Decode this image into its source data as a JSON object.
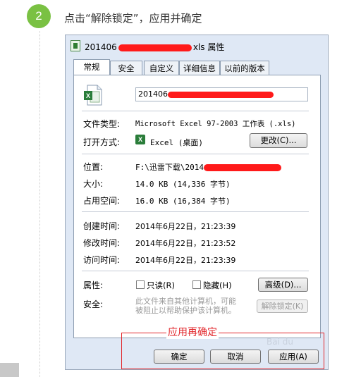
{
  "step": {
    "number": "2",
    "instruction": "点击“解除锁定”，应用并确定"
  },
  "dialog": {
    "title_prefix": "201406",
    "title_suffix": "xls 属性",
    "tabs": [
      {
        "label": "常规",
        "active": true
      },
      {
        "label": "安全",
        "active": false
      },
      {
        "label": "自定义",
        "active": false
      },
      {
        "label": "详细信息",
        "active": false
      },
      {
        "label": "以前的版本",
        "active": false
      }
    ],
    "file_name": "201406",
    "file_type_label": "文件类型:",
    "file_type_value": "Microsoft Excel 97-2003 工作表 (.xls)",
    "opens_with_label": "打开方式:",
    "opens_with_value": "Excel (桌面)",
    "change_button": "更改(C)...",
    "location_label": "位置:",
    "location_value": "F:\\迅雷下载\\2014",
    "size_label": "大小:",
    "size_value": "14.0 KB (14,336 字节)",
    "disk_size_label": "占用空间:",
    "disk_size_value": "16.0 KB (16,384 字节)",
    "created_label": "创建时间:",
    "created_value": "2014年6月22日，21:23:39",
    "modified_label": "修改时间:",
    "modified_value": "2014年6月22日，21:23:52",
    "accessed_label": "访问时间:",
    "accessed_value": "2014年6月22日，21:23:39",
    "attributes_label": "属性:",
    "readonly_label": "只读(R)",
    "hidden_label": "隐藏(H)",
    "advanced_button": "高级(D)...",
    "security_label": "安全:",
    "security_text_line1": "此文件来自其他计算机，可能",
    "security_text_line2": "被阻止以帮助保护该计算机。",
    "unblock_button": "解除锁定(K)",
    "ok_button": "确定",
    "cancel_button": "取消",
    "apply_button": "应用(A)"
  },
  "annotation": {
    "text": "应用再确定"
  },
  "watermark": "Bai du",
  "colors": {
    "step_green": "#7ac143",
    "annotation_red": "#e2262b",
    "redaction_red": "#ff1a1a"
  }
}
